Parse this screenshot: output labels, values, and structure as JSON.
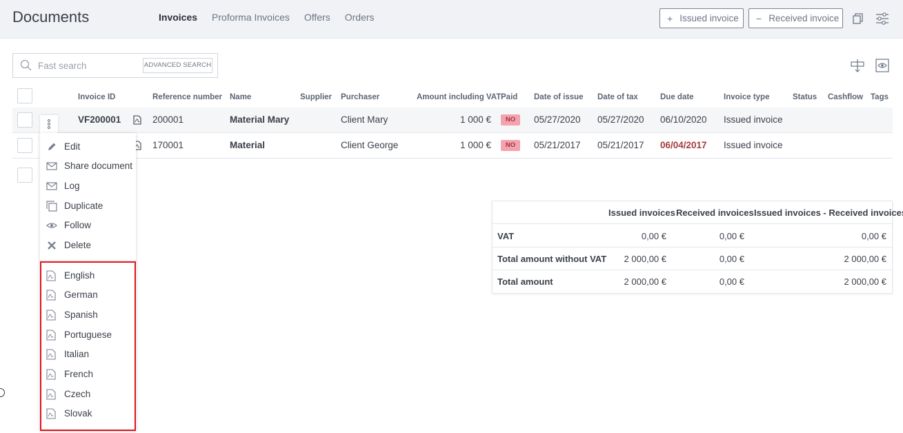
{
  "header": {
    "title": "Documents",
    "tabs": [
      {
        "label": "Invoices",
        "active": true
      },
      {
        "label": "Proforma Invoices",
        "active": false
      },
      {
        "label": "Offers",
        "active": false
      },
      {
        "label": "Orders",
        "active": false
      }
    ],
    "issued_btn": {
      "symbol": "+",
      "label": "Issued invoice"
    },
    "received_btn": {
      "symbol": "−",
      "label": "Received invoice"
    }
  },
  "search": {
    "placeholder": "Fast search",
    "advanced_label": "ADVANCED SEARCH"
  },
  "table": {
    "columns": [
      "Invoice ID",
      "Reference number",
      "Name",
      "Supplier",
      "Purchaser",
      "Amount including VAT",
      "Paid",
      "Date of issue",
      "Date of tax",
      "Due date",
      "Invoice type",
      "Status",
      "Cashflow",
      "Tags"
    ],
    "rows": [
      {
        "id": "VF200001",
        "ref": "200001",
        "name": "Material Mary",
        "supplier": "",
        "purchaser": "Client Mary",
        "amount": "1 000 €",
        "paid": "NO",
        "issue": "05/27/2020",
        "tax": "05/27/2020",
        "due": "06/10/2020",
        "type": "Issued invoice",
        "overdue": false
      },
      {
        "id": "",
        "ref": "170001",
        "name": "Material",
        "supplier": "",
        "purchaser": "Client George",
        "amount": "1 000 €",
        "paid": "NO",
        "issue": "05/21/2017",
        "tax": "05/21/2017",
        "due": "06/04/2017",
        "type": "Issued invoice",
        "overdue": true
      }
    ]
  },
  "context_menu": {
    "actions": [
      {
        "label": "Edit",
        "icon": "pencil-icon"
      },
      {
        "label": "Share document",
        "icon": "envelope-icon"
      },
      {
        "label": "Log",
        "icon": "envelope-icon"
      },
      {
        "label": "Duplicate",
        "icon": "copy-icon"
      },
      {
        "label": "Follow",
        "icon": "eye-icon"
      },
      {
        "label": "Delete",
        "icon": "close-icon"
      }
    ],
    "pdf_languages": [
      "English",
      "German",
      "Spanish",
      "Portuguese",
      "Italian",
      "French",
      "Czech",
      "Slovak"
    ],
    "highlight_color": "#e0111a"
  },
  "summary": {
    "headers": [
      "Issued invoices",
      "Received invoices",
      "Issued invoices - Received invoices"
    ],
    "rows": [
      {
        "label": "VAT",
        "issued": "0,00 €",
        "received": "0,00 €",
        "diff": "0,00 €"
      },
      {
        "label": "Total amount without VAT",
        "issued": "2 000,00 €",
        "received": "0,00 €",
        "diff": "2 000,00 €"
      },
      {
        "label": "Total amount",
        "issued": "2 000,00 €",
        "received": "0,00 €",
        "diff": "2 000,00 €"
      }
    ]
  },
  "colors": {
    "overdue": "#a53b3b",
    "unpaid_badge": "#f3a3ad",
    "topbar": "#f0f2f5"
  }
}
